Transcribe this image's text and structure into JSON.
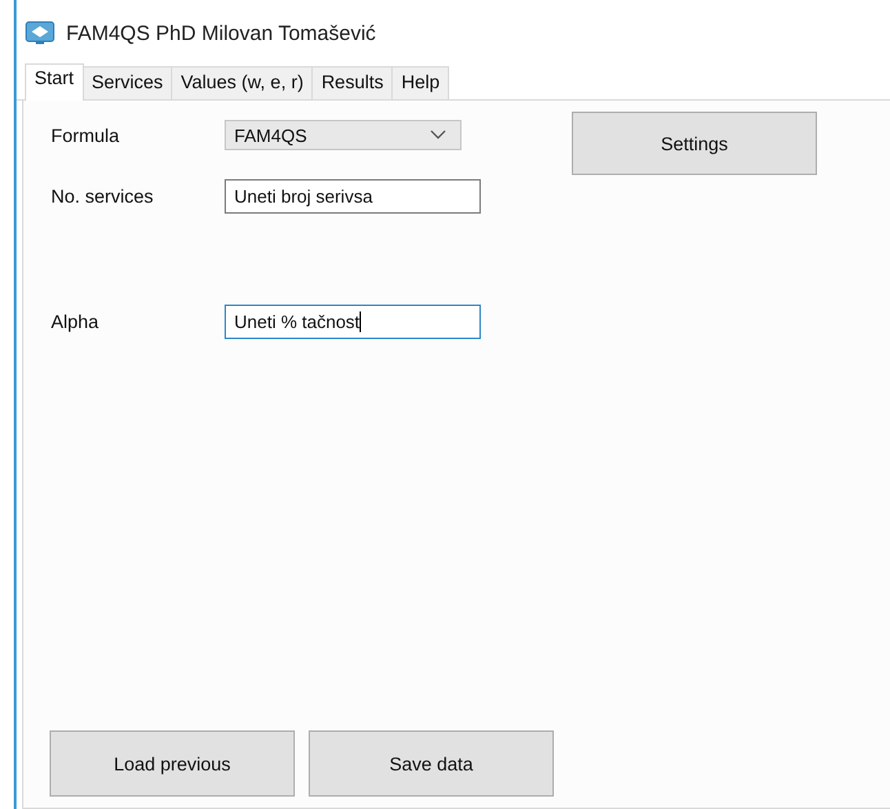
{
  "window": {
    "title": "FAM4QS PhD Milovan Tomašević"
  },
  "tabs": [
    {
      "label": "Start",
      "selected": true
    },
    {
      "label": "Services",
      "selected": false
    },
    {
      "label": "Values (w, e, r)",
      "selected": false
    },
    {
      "label": "Results",
      "selected": false
    },
    {
      "label": "Help",
      "selected": false
    }
  ],
  "formula": {
    "label": "Formula",
    "value": "FAM4QS"
  },
  "settings_button": "Settings",
  "services": {
    "label": "No. services",
    "value": "Uneti broj serivsa",
    "focused": false
  },
  "alpha": {
    "label": "Alpha",
    "value": "Uneti % tačnost",
    "focused": true
  },
  "buttons": [
    "Load previous",
    "Save data"
  ]
}
